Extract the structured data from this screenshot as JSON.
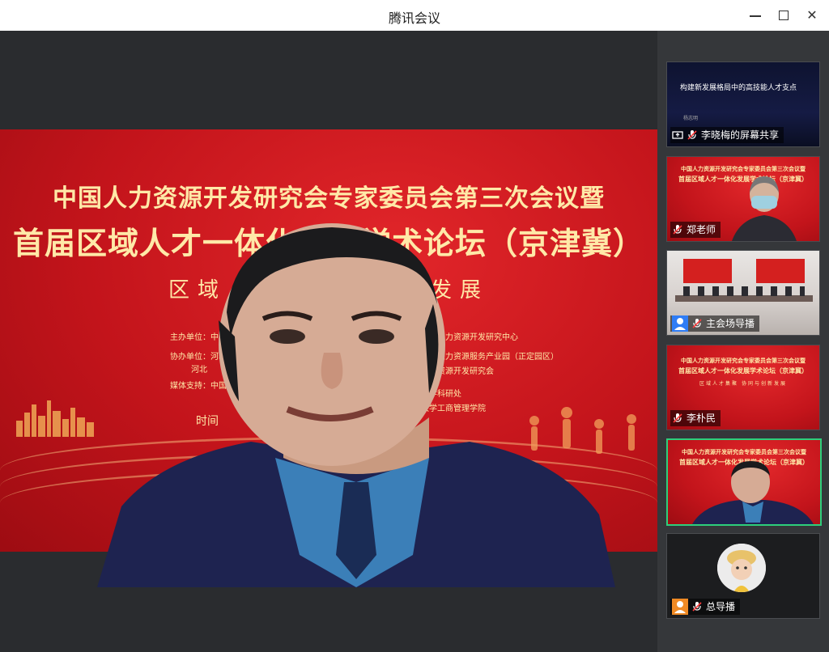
{
  "window": {
    "title": "腾讯会议"
  },
  "banner": {
    "line1": "中国人力资源开发研究会专家委员会第三次会议暨",
    "line2": "首届区域人才一体化发展学术论坛（京津冀）",
    "line3": "区域人才集聚与创新发展",
    "host_label": "主办单位：中",
    "co_label": "协办单位：河北",
    "co_label2": "河北",
    "media_label": "媒体支持：中国",
    "org1": "冀协同发展人力资源开发研究中心",
    "org2": "河北石家庄人力资源服务产业园（正定园区）",
    "org3": "河北省人力资源开发研究会",
    "org4": "河北经贸大学科研处",
    "org5": "河北经贸大学工商管理学院",
    "time": "时间"
  },
  "participants": [
    {
      "name": "李晓梅的屏幕共享",
      "share_title": "构建新发展格局中的高技能人才支点",
      "share_author": "杨志明"
    },
    {
      "name": "郑老师"
    },
    {
      "name": "主会场导播"
    },
    {
      "name": "李朴民"
    },
    {
      "name": ""
    },
    {
      "name": "总导播"
    }
  ],
  "mini_banner": {
    "line1": "中国人力资源开发研究会专家委员会第三次会议暨",
    "line2": "首届区域人才一体化发展学术论坛（京津冀）",
    "line3": "区域人才集聚  协同与创新发展"
  },
  "colors": {
    "banner_red": "#c3141b",
    "banner_text": "#ffe9a8",
    "active_border": "#2dcf7b",
    "sidebar_bg": "#35373a"
  }
}
